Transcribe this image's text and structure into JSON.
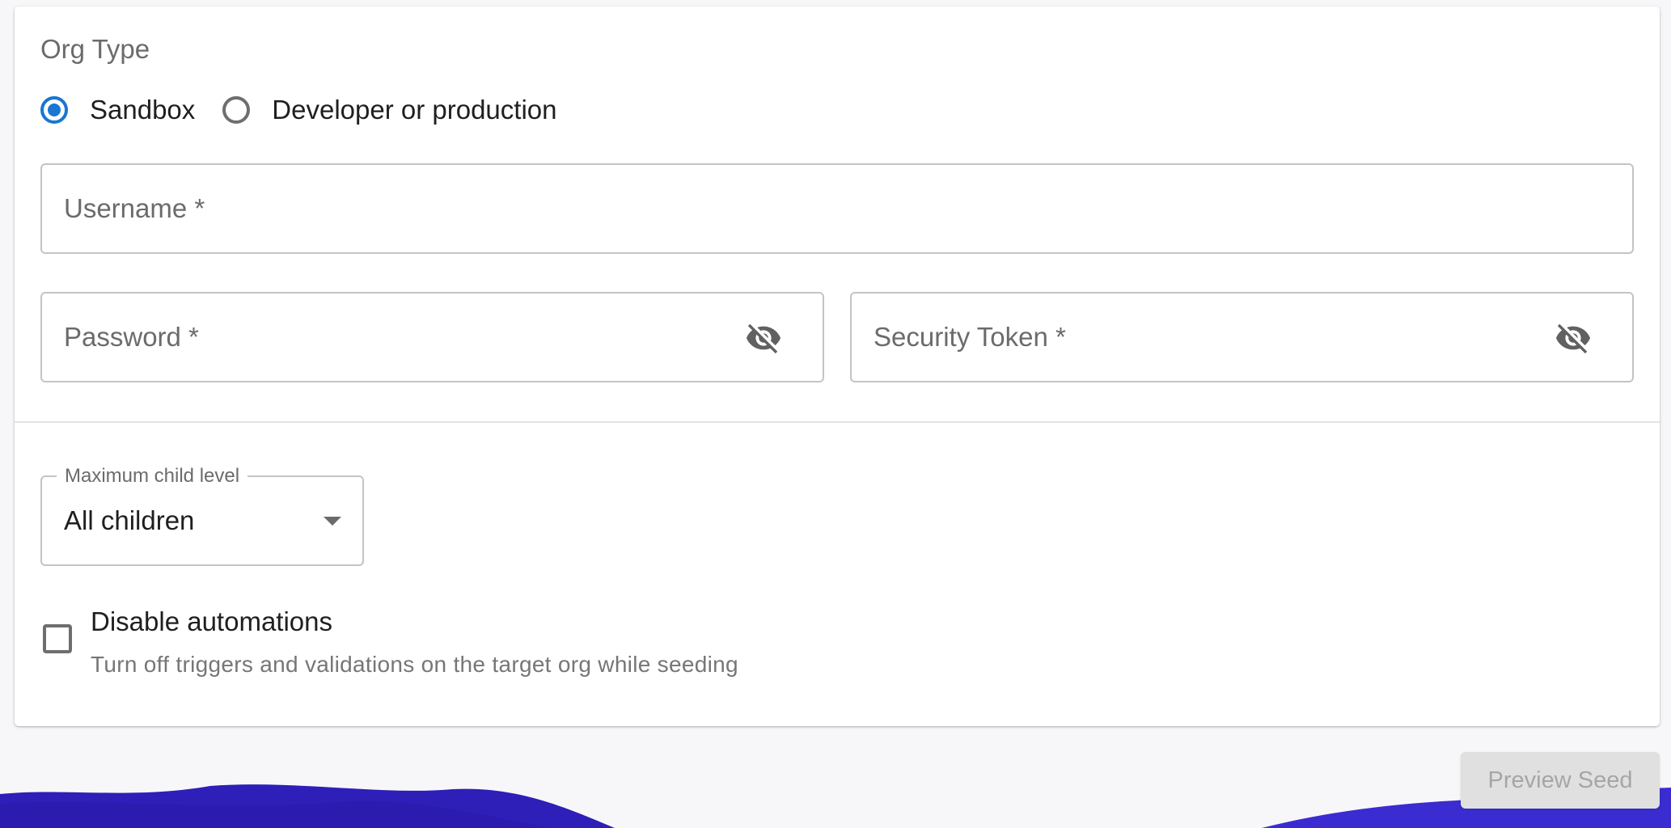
{
  "form": {
    "org_type": {
      "label": "Org Type",
      "options": [
        {
          "label": "Sandbox",
          "selected": true
        },
        {
          "label": "Developer or production",
          "selected": false
        }
      ]
    },
    "username": {
      "label": "Username *",
      "value": ""
    },
    "password": {
      "label": "Password *",
      "value": "",
      "icon": "visibility-off-icon"
    },
    "security_token": {
      "label": "Security Token *",
      "value": "",
      "icon": "visibility-off-icon"
    },
    "max_child_level": {
      "label": "Maximum child level",
      "value": "All children"
    },
    "disable_automations": {
      "label": "Disable automations",
      "description": "Turn off triggers and validations on the target org while seeding",
      "checked": false
    }
  },
  "actions": {
    "preview_label": "Preview Seed",
    "preview_disabled": true
  },
  "colors": {
    "accent": "#1976d2",
    "wave": "#2d1fb8",
    "disabled_button": "#e0e0e0"
  }
}
